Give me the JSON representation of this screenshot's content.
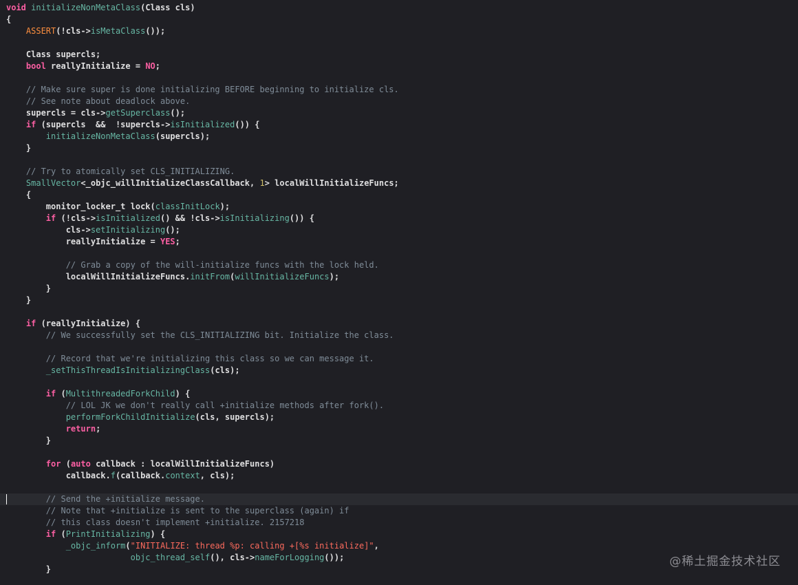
{
  "editor": {
    "watermark": "@稀土掘金技术社区",
    "lines": [
      [
        [
          "void",
          "kw"
        ],
        [
          " ",
          "pl"
        ],
        [
          "initializeNonMetaClass",
          "fn"
        ],
        [
          "(Class cls)",
          "pl bold"
        ]
      ],
      [
        [
          "{",
          "pl bold"
        ]
      ],
      [
        [
          "    ",
          "pl"
        ],
        [
          "ASSERT",
          "mac"
        ],
        [
          "(!cls->",
          "pl bold"
        ],
        [
          "isMetaClass",
          "fn"
        ],
        [
          "());",
          "pl bold"
        ]
      ],
      [],
      [
        [
          "    ",
          "pl"
        ],
        [
          "Class supercls;",
          "pl bold"
        ]
      ],
      [
        [
          "    ",
          "pl"
        ],
        [
          "bool",
          "kw"
        ],
        [
          " reallyInitialize = ",
          "pl bold"
        ],
        [
          "NO",
          "kw"
        ],
        [
          ";",
          "pl bold"
        ]
      ],
      [],
      [
        [
          "    // Make sure super is done initializing BEFORE beginning to initialize cls.",
          "cm"
        ]
      ],
      [
        [
          "    // See note about deadlock above.",
          "cm"
        ]
      ],
      [
        [
          "    ",
          "pl"
        ],
        [
          "supercls = cls->",
          "pl bold"
        ],
        [
          "getSuperclass",
          "fn"
        ],
        [
          "();",
          "pl bold"
        ]
      ],
      [
        [
          "    ",
          "pl"
        ],
        [
          "if",
          "kw"
        ],
        [
          " (supercls  &&  !supercls->",
          "pl bold"
        ],
        [
          "isInitialized",
          "fn"
        ],
        [
          "()) {",
          "pl bold"
        ]
      ],
      [
        [
          "        ",
          "pl"
        ],
        [
          "initializeNonMetaClass",
          "fn"
        ],
        [
          "(supercls);",
          "pl bold"
        ]
      ],
      [
        [
          "    ",
          "pl"
        ],
        [
          "}",
          "pl bold"
        ]
      ],
      [],
      [
        [
          "    // Try to atomically set CLS_INITIALIZING.",
          "cm"
        ]
      ],
      [
        [
          "    ",
          "pl"
        ],
        [
          "SmallVector",
          "fn"
        ],
        [
          "<_objc_willInitializeClassCallback, ",
          "pl bold"
        ],
        [
          "1",
          "nm"
        ],
        [
          "> localWillInitializeFuncs;",
          "pl bold"
        ]
      ],
      [
        [
          "    ",
          "pl"
        ],
        [
          "{",
          "pl bold"
        ]
      ],
      [
        [
          "        ",
          "pl"
        ],
        [
          "monitor_locker_t lock(",
          "pl bold"
        ],
        [
          "classInitLock",
          "fn"
        ],
        [
          ");",
          "pl bold"
        ]
      ],
      [
        [
          "        ",
          "pl"
        ],
        [
          "if",
          "kw"
        ],
        [
          " (!cls->",
          "pl bold"
        ],
        [
          "isInitialized",
          "fn"
        ],
        [
          "() && !cls->",
          "pl bold"
        ],
        [
          "isInitializing",
          "fn"
        ],
        [
          "()) {",
          "pl bold"
        ]
      ],
      [
        [
          "            ",
          "pl"
        ],
        [
          "cls->",
          "pl bold"
        ],
        [
          "setInitializing",
          "fn"
        ],
        [
          "();",
          "pl bold"
        ]
      ],
      [
        [
          "            ",
          "pl"
        ],
        [
          "reallyInitialize = ",
          "pl bold"
        ],
        [
          "YES",
          "kw"
        ],
        [
          ";",
          "pl bold"
        ]
      ],
      [],
      [
        [
          "            // Grab a copy of the will-initialize funcs with the lock held.",
          "cm"
        ]
      ],
      [
        [
          "            ",
          "pl"
        ],
        [
          "localWillInitializeFuncs.",
          "pl bold"
        ],
        [
          "initFrom",
          "fn"
        ],
        [
          "(",
          "pl bold"
        ],
        [
          "willInitializeFuncs",
          "fn"
        ],
        [
          ");",
          "pl bold"
        ]
      ],
      [
        [
          "        ",
          "pl"
        ],
        [
          "}",
          "pl bold"
        ]
      ],
      [
        [
          "    ",
          "pl"
        ],
        [
          "}",
          "pl bold"
        ]
      ],
      [],
      [
        [
          "    ",
          "pl"
        ],
        [
          "if",
          "kw"
        ],
        [
          " (reallyInitialize) {",
          "pl bold"
        ]
      ],
      [
        [
          "        // We successfully set the CLS_INITIALIZING bit. Initialize the class.",
          "cm"
        ]
      ],
      [],
      [
        [
          "        // Record that we're initializing this class so we can message it.",
          "cm"
        ]
      ],
      [
        [
          "        ",
          "pl"
        ],
        [
          "_setThisThreadIsInitializingClass",
          "fn"
        ],
        [
          "(cls);",
          "pl bold"
        ]
      ],
      [],
      [
        [
          "        ",
          "pl"
        ],
        [
          "if",
          "kw"
        ],
        [
          " (",
          "pl bold"
        ],
        [
          "MultithreadedForkChild",
          "fn"
        ],
        [
          ") {",
          "pl bold"
        ]
      ],
      [
        [
          "            // LOL JK we don't really call +initialize methods after fork().",
          "cm"
        ]
      ],
      [
        [
          "            ",
          "pl"
        ],
        [
          "performForkChildInitialize",
          "fn"
        ],
        [
          "(cls, supercls);",
          "pl bold"
        ]
      ],
      [
        [
          "            ",
          "pl"
        ],
        [
          "return",
          "kw"
        ],
        [
          ";",
          "pl bold"
        ]
      ],
      [
        [
          "        ",
          "pl"
        ],
        [
          "}",
          "pl bold"
        ]
      ],
      [],
      [
        [
          "        ",
          "pl"
        ],
        [
          "for",
          "kw"
        ],
        [
          " (",
          "pl bold"
        ],
        [
          "auto",
          "kw"
        ],
        [
          " callback : localWillInitializeFuncs)",
          "pl bold"
        ]
      ],
      [
        [
          "            ",
          "pl"
        ],
        [
          "callback.",
          "pl bold"
        ],
        [
          "f",
          "fn"
        ],
        [
          "(callback.",
          "pl bold"
        ],
        [
          "context",
          "fn"
        ],
        [
          ", cls);",
          "pl bold"
        ]
      ],
      [],
      [
        [
          "        // Send the +initialize message.",
          "cm"
        ]
      ],
      [
        [
          "        // Note that +initialize is sent to the superclass (again) if",
          "cm"
        ]
      ],
      [
        [
          "        // this class doesn't implement +initialize. 2157218",
          "cm"
        ]
      ],
      [
        [
          "        ",
          "pl"
        ],
        [
          "if",
          "kw"
        ],
        [
          " (",
          "pl bold"
        ],
        [
          "PrintInitializing",
          "fn"
        ],
        [
          ") {",
          "pl bold"
        ]
      ],
      [
        [
          "            ",
          "pl"
        ],
        [
          "_objc_inform",
          "fn"
        ],
        [
          "(",
          "pl bold"
        ],
        [
          "\"INITIALIZE: thread %p: calling +[%s initialize]\"",
          "st"
        ],
        [
          ",",
          "pl bold"
        ]
      ],
      [
        [
          "                         ",
          "pl"
        ],
        [
          "objc_thread_self",
          "fn"
        ],
        [
          "(), cls->",
          "pl bold"
        ],
        [
          "nameForLogging",
          "fn"
        ],
        [
          "());",
          "pl bold"
        ]
      ],
      [
        [
          "        ",
          "pl"
        ],
        [
          "}",
          "pl bold"
        ]
      ]
    ],
    "current_line": 42
  }
}
